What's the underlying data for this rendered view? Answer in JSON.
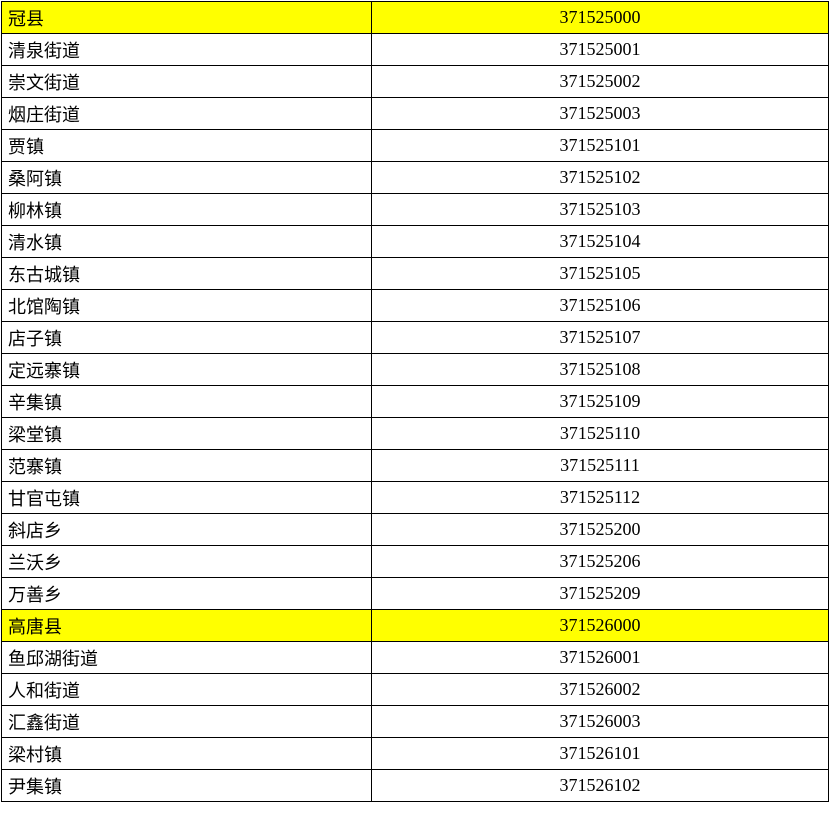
{
  "rows": [
    {
      "name": "冠县",
      "code": "371525000",
      "highlighted": true
    },
    {
      "name": "清泉街道",
      "code": "371525001",
      "highlighted": false
    },
    {
      "name": "崇文街道",
      "code": "371525002",
      "highlighted": false
    },
    {
      "name": "烟庄街道",
      "code": "371525003",
      "highlighted": false
    },
    {
      "name": "贾镇",
      "code": "371525101",
      "highlighted": false
    },
    {
      "name": "桑阿镇",
      "code": "371525102",
      "highlighted": false
    },
    {
      "name": "柳林镇",
      "code": "371525103",
      "highlighted": false
    },
    {
      "name": "清水镇",
      "code": "371525104",
      "highlighted": false
    },
    {
      "name": "东古城镇",
      "code": "371525105",
      "highlighted": false
    },
    {
      "name": "北馆陶镇",
      "code": "371525106",
      "highlighted": false
    },
    {
      "name": "店子镇",
      "code": "371525107",
      "highlighted": false
    },
    {
      "name": "定远寨镇",
      "code": "371525108",
      "highlighted": false
    },
    {
      "name": "辛集镇",
      "code": "371525109",
      "highlighted": false
    },
    {
      "name": "梁堂镇",
      "code": "371525110",
      "highlighted": false
    },
    {
      "name": "范寨镇",
      "code": "371525111",
      "highlighted": false
    },
    {
      "name": "甘官屯镇",
      "code": "371525112",
      "highlighted": false
    },
    {
      "name": "斜店乡",
      "code": "371525200",
      "highlighted": false
    },
    {
      "name": "兰沃乡",
      "code": "371525206",
      "highlighted": false
    },
    {
      "name": "万善乡",
      "code": "371525209",
      "highlighted": false
    },
    {
      "name": "高唐县",
      "code": "371526000",
      "highlighted": true
    },
    {
      "name": "鱼邱湖街道",
      "code": "371526001",
      "highlighted": false
    },
    {
      "name": "人和街道",
      "code": "371526002",
      "highlighted": false
    },
    {
      "name": "汇鑫街道",
      "code": "371526003",
      "highlighted": false
    },
    {
      "name": "梁村镇",
      "code": "371526101",
      "highlighted": false
    },
    {
      "name": "尹集镇",
      "code": "371526102",
      "highlighted": false
    }
  ]
}
